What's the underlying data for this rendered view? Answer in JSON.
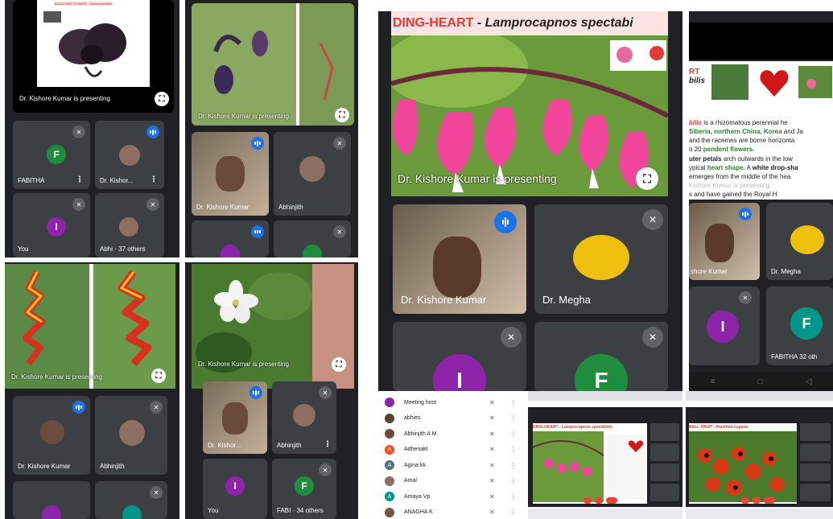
{
  "panel1": {
    "slide_caption": "BLACK BAT FLOWER - Tacca chantrieri",
    "presenting": "Dr. Kishore Kumar is presenting",
    "tiles": [
      {
        "name": "FABITHA",
        "letter": "F",
        "color": "#1e8e3e"
      },
      {
        "name": "Dr. Kishor..."
      },
      {
        "name": "You",
        "letter": "I",
        "color": "#8e24aa"
      },
      {
        "name": "Abhi",
        "others": "37 others"
      }
    ]
  },
  "panel2": {
    "presenting": "Dr. Kishore Kumar is presenting",
    "tiles": [
      {
        "name": "Dr. Kishore Kumar"
      },
      {
        "name": "Abhinjith"
      }
    ]
  },
  "panel3": {
    "presenting": "Dr. Kishore Kumar is presenting",
    "tiles": [
      {
        "name": "Dr. Kishore Kumar"
      },
      {
        "name": "Abhinjith"
      }
    ]
  },
  "panel4": {
    "presenting": "Dr. Kishore Kumar is presenting",
    "tiles": [
      {
        "name": "Dr. Kishor..."
      },
      {
        "name": "Abhinjith"
      },
      {
        "name": "You",
        "letter": "I",
        "color": "#8e24aa"
      },
      {
        "name": "FABI",
        "letter": "F",
        "color": "#1e8e3e",
        "others": "34 others"
      }
    ]
  },
  "panel5": {
    "slide_title_red": "DING-HEART",
    "slide_title_sep": " - ",
    "slide_title_italic": "Lamprocapnos spectabi",
    "presenting": "Dr. Kishore Kumar is presenting",
    "tiles": [
      {
        "name": "Dr. Kishore Kumar"
      },
      {
        "name": "Dr. Megha"
      },
      {
        "letter": "I",
        "color": "#8e24aa"
      },
      {
        "letter": "F",
        "color": "#1e8e3e"
      }
    ]
  },
  "panel6": {
    "slide_heading_1": "RT",
    "slide_heading_2": "bilis",
    "lines": [
      {
        "prefix": "bilis",
        "text": " is a rhizomatous perennial he"
      },
      {
        "green": "Siberia, northern China, Korea",
        "text": " and Ja"
      },
      {
        "text": "and the racemes are borne horizonta"
      },
      {
        "text": "o 20 ",
        "green": "pendent flowers."
      },
      {
        "bold": "uter petals",
        "text": " arch outwards in the low"
      },
      {
        "text": "ypical ",
        "green": "heart shape.",
        "text2": " A ",
        "bold": "white drop-sha"
      },
      {
        "text": " emerges from the middle of the hea"
      },
      {
        "text": "Kishore Kumar is presenting"
      },
      {
        "text": "s  and  have  gained  the  Royal  H"
      }
    ],
    "tiles": [
      {
        "name": "shore Kumar"
      },
      {
        "name": "Dr. Megha"
      },
      {
        "letter": "I",
        "color": "#8e24aa"
      },
      {
        "letter": "F",
        "color": "#1e8e3e",
        "name": "FABITHA",
        "others": "32 oth"
      }
    ]
  },
  "panel7": {
    "participants": [
      {
        "name": "Meeting host",
        "color": "#8e24aa",
        "letter": ""
      },
      {
        "name": "abhies",
        "color": "#5d4037",
        "letter": ""
      },
      {
        "name": "Abhinjith A M",
        "color": "#6d4c41",
        "letter": ""
      },
      {
        "name": "Adhenakt",
        "color": "#f4511e",
        "letter": "A"
      },
      {
        "name": "Agina kk",
        "color": "#546e7a",
        "letter": "A"
      },
      {
        "name": "Amal",
        "color": "#8d6e63",
        "letter": ""
      },
      {
        "name": "Amaya Vp",
        "color": "#009688",
        "letter": "A"
      },
      {
        "name": "ANAGHA K",
        "color": "#795548",
        "letter": ""
      }
    ]
  },
  "panel8": {
    "slide_title": "DING-HEART - Lamprocapnos spectabilis"
  },
  "panel9": {
    "slide_title": "BALL FRUIT - Paullinia cupana"
  }
}
